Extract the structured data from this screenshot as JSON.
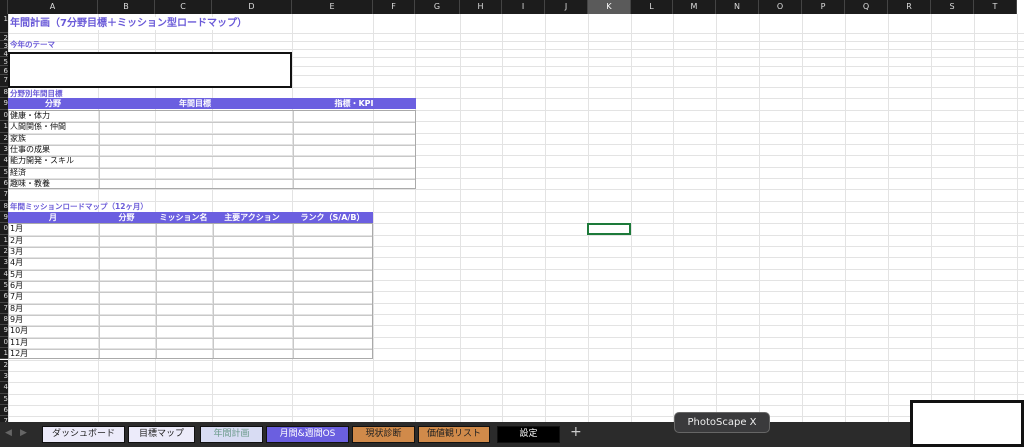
{
  "columns": [
    "A",
    "B",
    "C",
    "D",
    "E",
    "F",
    "G",
    "H",
    "I",
    "J",
    "K",
    "L",
    "M",
    "N",
    "O",
    "P",
    "Q",
    "R",
    "S",
    "T"
  ],
  "selected_column": "K",
  "sheet": {
    "title": "年間計画（7分野目標＋ミッション型ロードマップ）",
    "theme_label": "今年のテーマ",
    "goals_label": "分野別年間目標",
    "goals_headers": [
      "分野",
      "年間目標",
      "指標・KPI"
    ],
    "goals_rows": [
      "健康・体力",
      "人間関係・仲間",
      "家族",
      "仕事の成果",
      "能力開発・スキル",
      "経済",
      "趣味・教養"
    ],
    "roadmap_label": "年間ミッションロードマップ（12ヶ月）",
    "roadmap_headers": [
      "月",
      "分野",
      "ミッション名",
      "主要アクション",
      "ランク（S/A/B）"
    ],
    "roadmap_rows": [
      "1月",
      "2月",
      "3月",
      "4月",
      "5月",
      "6月",
      "7月",
      "8月",
      "9月",
      "10月",
      "11月",
      "12月"
    ]
  },
  "tabs": [
    {
      "label": "ダッシュボード",
      "bg": "#ecebfa",
      "fg": "#222"
    },
    {
      "label": "目標マップ",
      "bg": "#ecebfa",
      "fg": "#222"
    },
    {
      "label": "年間計画",
      "bg": "#d8dcf3",
      "fg": "#6a9a8a"
    },
    {
      "label": "月間&週間OS",
      "bg": "#6b5fe0",
      "fg": "#fff"
    },
    {
      "label": "現状診断",
      "bg": "#d08a4a",
      "fg": "#222"
    },
    {
      "label": "価値観リスト",
      "bg": "#d08a4a",
      "fg": "#222"
    },
    {
      "label": "設定",
      "bg": "#000",
      "fg": "#fff"
    }
  ],
  "add_sheet": "+",
  "tooltip": "PhotoScape X"
}
